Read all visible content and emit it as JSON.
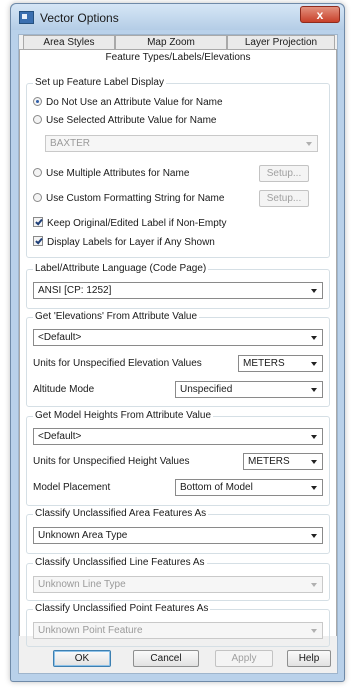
{
  "window": {
    "title": "Vector Options",
    "close_glyph": "x"
  },
  "tabs": {
    "row1": [
      "Area Styles",
      "Map Zoom",
      "Layer Projection"
    ],
    "active": "Feature Types/Labels/Elevations"
  },
  "feature_label": {
    "group_label": "Set up Feature Label Display",
    "opt_no_attribute": "Do Not Use an Attribute Value for Name",
    "opt_selected_attribute": "Use Selected Attribute Value for Name",
    "attribute_value": "BAXTER",
    "opt_multiple": "Use Multiple Attributes for Name",
    "opt_custom": "Use Custom Formatting String for Name",
    "setup_label": "Setup...",
    "chk_keep": "Keep Original/Edited Label if Non-Empty",
    "chk_display": "Display Labels for Layer if Any Shown"
  },
  "language": {
    "group_label": "Label/Attribute Language (Code Page)",
    "value": "ANSI [CP: 1252]"
  },
  "elevations": {
    "group_label": "Get 'Elevations' From Attribute Value",
    "value": "<Default>",
    "units_label": "Units for Unspecified Elevation Values",
    "units_value": "METERS",
    "altitude_label": "Altitude Mode",
    "altitude_value": "Unspecified"
  },
  "heights": {
    "group_label": "Get Model Heights From Attribute Value",
    "value": "<Default>",
    "units_label": "Units for Unspecified Height Values",
    "units_value": "METERS",
    "placement_label": "Model Placement",
    "placement_value": "Bottom of Model"
  },
  "classify_area": {
    "group_label": "Classify Unclassified Area Features As",
    "value": "Unknown Area Type"
  },
  "classify_line": {
    "group_label": "Classify Unclassified Line Features As",
    "value": "Unknown Line Type"
  },
  "classify_point": {
    "group_label": "Classify Unclassified Point Features As",
    "value": "Unknown Point Feature"
  },
  "footer": {
    "ok": "OK",
    "cancel": "Cancel",
    "apply": "Apply",
    "help": "Help"
  }
}
